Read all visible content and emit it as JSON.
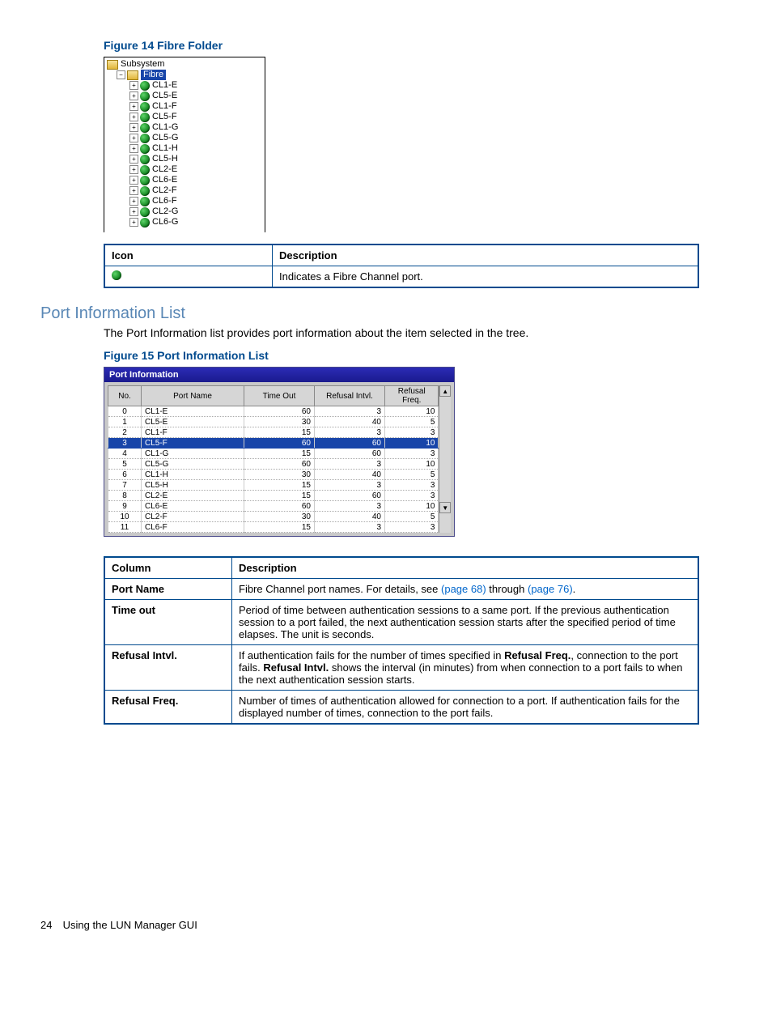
{
  "figure14": {
    "caption": "Figure 14 Fibre Folder",
    "tree": {
      "root": "Subsystem",
      "selected": "Fibre",
      "ports": [
        "CL1-E",
        "CL5-E",
        "CL1-F",
        "CL5-F",
        "CL1-G",
        "CL5-G",
        "CL1-H",
        "CL5-H",
        "CL2-E",
        "CL6-E",
        "CL2-F",
        "CL6-F",
        "CL2-G",
        "CL6-G"
      ]
    }
  },
  "iconTable": {
    "headers": [
      "Icon",
      "Description"
    ],
    "row_desc": "Indicates a Fibre Channel port."
  },
  "section": {
    "heading": "Port Information List",
    "text": "The Port Information list provides port information about the item selected in the tree."
  },
  "figure15": {
    "caption": "Figure 15 Port Information List",
    "panel_title": "Port Information",
    "columns": [
      "No.",
      "Port Name",
      "Time Out",
      "Refusal Intvl.",
      "Refusal Freq."
    ],
    "selected_index": 3,
    "chart_data": {
      "type": "table",
      "columns": [
        "No.",
        "Port Name",
        "Time Out",
        "Refusal Intvl.",
        "Refusal Freq."
      ],
      "rows": [
        {
          "no": 0,
          "port": "CL1-E",
          "timeout": 60,
          "intvl": 3,
          "freq": 10
        },
        {
          "no": 1,
          "port": "CL5-E",
          "timeout": 30,
          "intvl": 40,
          "freq": 5
        },
        {
          "no": 2,
          "port": "CL1-F",
          "timeout": 15,
          "intvl": 3,
          "freq": 3
        },
        {
          "no": 3,
          "port": "CL5-F",
          "timeout": 60,
          "intvl": 60,
          "freq": 10
        },
        {
          "no": 4,
          "port": "CL1-G",
          "timeout": 15,
          "intvl": 60,
          "freq": 3
        },
        {
          "no": 5,
          "port": "CL5-G",
          "timeout": 60,
          "intvl": 3,
          "freq": 10
        },
        {
          "no": 6,
          "port": "CL1-H",
          "timeout": 30,
          "intvl": 40,
          "freq": 5
        },
        {
          "no": 7,
          "port": "CL5-H",
          "timeout": 15,
          "intvl": 3,
          "freq": 3
        },
        {
          "no": 8,
          "port": "CL2-E",
          "timeout": 15,
          "intvl": 60,
          "freq": 3
        },
        {
          "no": 9,
          "port": "CL6-E",
          "timeout": 60,
          "intvl": 3,
          "freq": 10
        },
        {
          "no": 10,
          "port": "CL2-F",
          "timeout": 30,
          "intvl": 40,
          "freq": 5
        },
        {
          "no": 11,
          "port": "CL6-F",
          "timeout": 15,
          "intvl": 3,
          "freq": 3
        }
      ]
    }
  },
  "columnTable": {
    "headers": [
      "Column",
      "Description"
    ],
    "rows": [
      {
        "col": "Port Name",
        "desc_pre": "Fibre Channel port names. For details, see ",
        "link1": "(page 68)",
        "desc_mid": " through ",
        "link2": "(page 76)",
        "desc_post": "."
      },
      {
        "col": "Time out",
        "desc": "Period of time between authentication sessions to a same port. If the previous authentication session to a port failed, the next authentication session starts after the specified period of time elapses. The unit is seconds."
      },
      {
        "col": "Refusal Intvl.",
        "desc_pre": "If authentication fails for the number of times specified in ",
        "bold1": "Refusal Freq.",
        "desc_mid": ", connection to the port fails. ",
        "bold2": "Refusal Intvl.",
        "desc_post": " shows the interval (in minutes) from when connection to a port fails to when the next authentication session starts."
      },
      {
        "col": "Refusal Freq.",
        "desc": "Number of times of authentication allowed for connection to a port. If authentication fails for the displayed number of times, connection to the port fails."
      }
    ]
  },
  "footer": {
    "page": "24",
    "title": "Using the LUN Manager GUI"
  }
}
